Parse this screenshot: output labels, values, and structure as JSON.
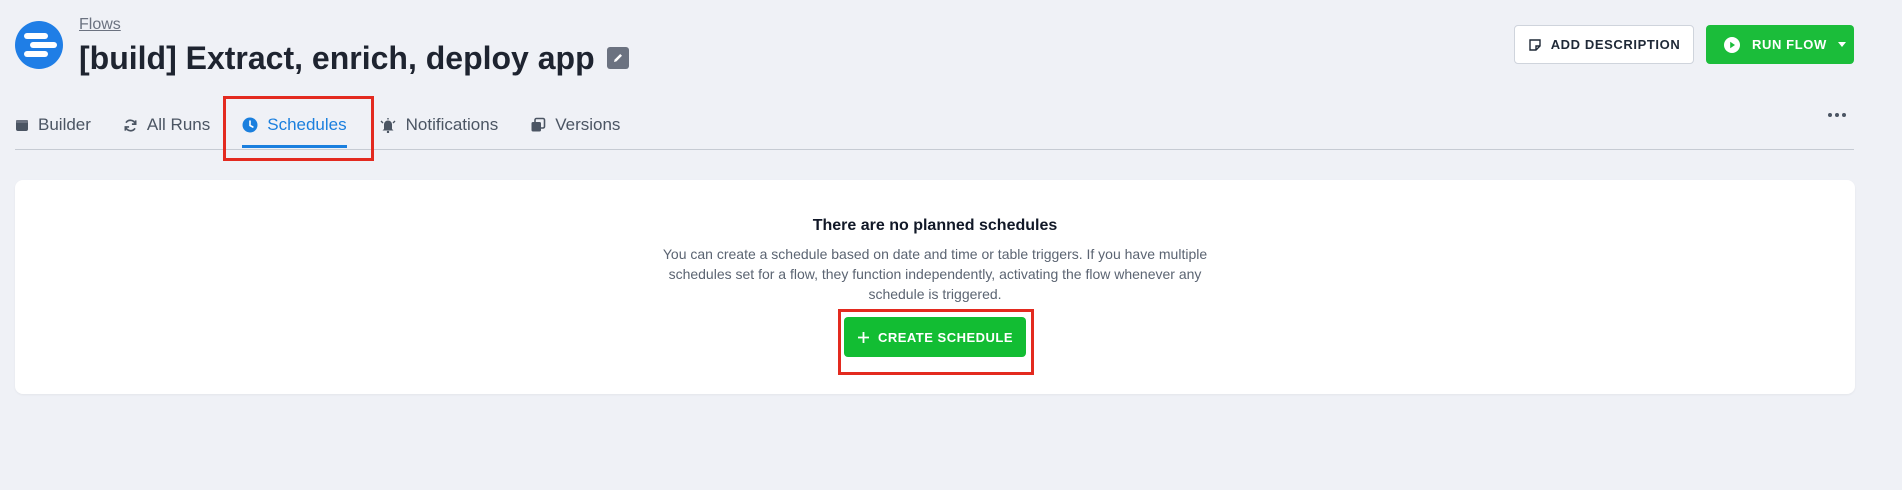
{
  "header": {
    "breadcrumb": "Flows",
    "title": "[build] Extract, enrich, deploy app",
    "add_description_label": "ADD DESCRIPTION",
    "run_flow_label": "RUN FLOW"
  },
  "tabs": [
    {
      "label": "Builder",
      "icon": "calendar-box-icon"
    },
    {
      "label": "All Runs",
      "icon": "refresh-icon"
    },
    {
      "label": "Schedules",
      "icon": "clock-icon",
      "active": true
    },
    {
      "label": "Notifications",
      "icon": "bell-icon"
    },
    {
      "label": "Versions",
      "icon": "versions-icon"
    }
  ],
  "empty_state": {
    "title": "There are no planned schedules",
    "description": "You can create a schedule based on date and time or table triggers. If you have multiple schedules set for a flow, they function independently, activating the flow whenever any schedule is triggered.",
    "create_label": "CREATE SCHEDULE"
  },
  "colors": {
    "accent_blue": "#1a7fde",
    "green": "#1bbd3a",
    "highlight_red": "#e32a1f",
    "background": "#eff1f6"
  }
}
